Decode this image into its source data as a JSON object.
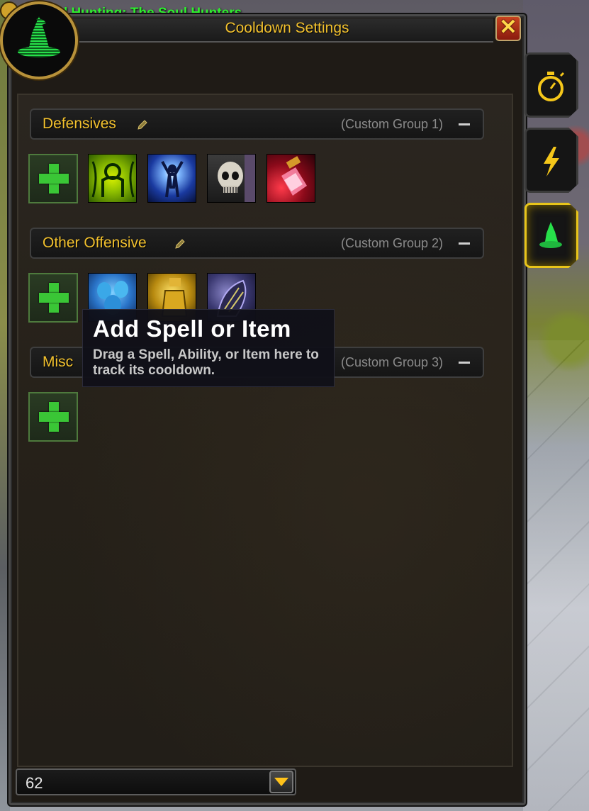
{
  "window": {
    "title": "Cooldown Settings",
    "close_icon": "close-icon",
    "portrait_icon": "wizard-hat-icon"
  },
  "background": {
    "quest_tracker_text": "l Hunting: The Soul Hunters"
  },
  "groups": [
    {
      "name": "Defensives",
      "subtitle": "(Custom Group 1)",
      "spells": [
        "rune-icon",
        "spirit-form-icon",
        "skull-icon",
        "potion-icon"
      ]
    },
    {
      "name": "Other Offensive",
      "subtitle": "(Custom Group 2)",
      "spells": [
        "spirits-icon",
        "golden-potion-icon",
        "dark-claw-icon"
      ]
    },
    {
      "name": "Misc",
      "subtitle": "(Custom Group 3)",
      "spells": []
    }
  ],
  "tooltip": {
    "title": "Add Spell or Item",
    "body": "Drag a Spell, Ability, or Item here to track its cooldown."
  },
  "side_tabs": [
    {
      "icon": "stopwatch-icon",
      "active": false
    },
    {
      "icon": "lightning-bolt-icon",
      "active": false
    },
    {
      "icon": "wizard-hat-icon",
      "active": true
    }
  ],
  "bottom": {
    "value": "62"
  },
  "colors": {
    "gold": "#f2c12e",
    "add_green": "#3ac636",
    "active_tab": "#e8c51a"
  }
}
